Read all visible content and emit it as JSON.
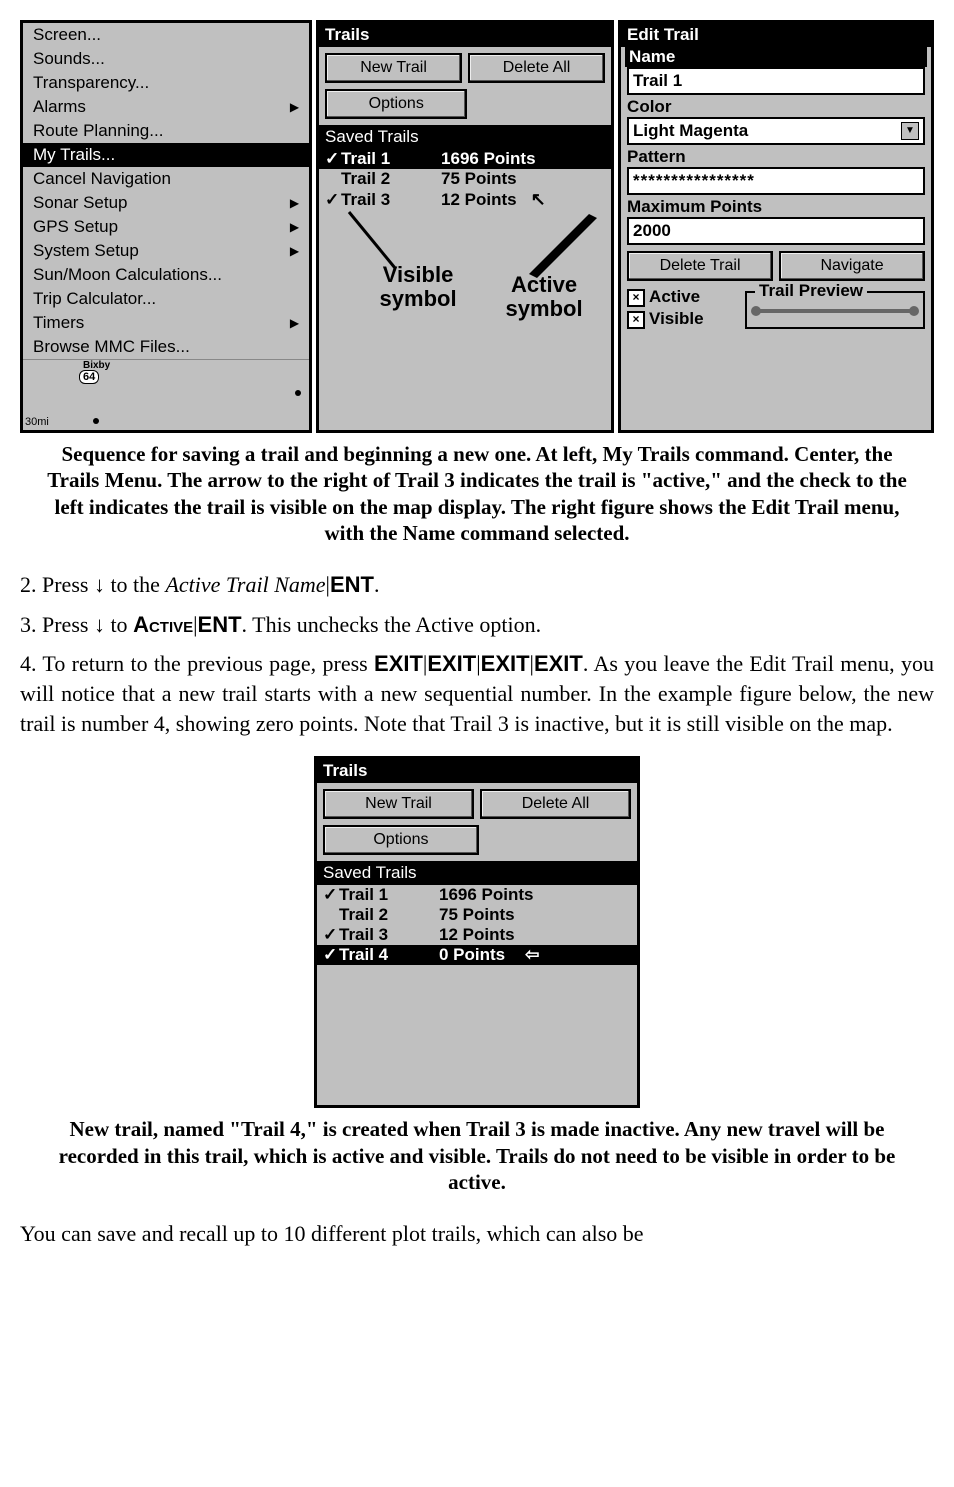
{
  "menu": {
    "items": [
      {
        "label": "Screen...",
        "sub": false
      },
      {
        "label": "Sounds...",
        "sub": false
      },
      {
        "label": "Transparency...",
        "sub": false
      },
      {
        "label": "Alarms",
        "sub": true
      },
      {
        "label": "Route Planning...",
        "sub": false
      },
      {
        "label": "My Trails...",
        "sub": false,
        "selected": true
      },
      {
        "label": "Cancel Navigation",
        "sub": false
      },
      {
        "label": "Sonar Setup",
        "sub": true
      },
      {
        "label": "GPS Setup",
        "sub": true
      },
      {
        "label": "System Setup",
        "sub": true
      },
      {
        "label": "Sun/Moon Calculations...",
        "sub": false
      },
      {
        "label": "Trip Calculator...",
        "sub": false
      },
      {
        "label": "Timers",
        "sub": true
      },
      {
        "label": "Browse MMC Files...",
        "sub": false
      }
    ],
    "map_label_top": "Bixby",
    "map_label_hwy": "64",
    "map_scale": "30mi"
  },
  "trails1": {
    "title": "Trails",
    "new_trail": "New Trail",
    "delete_all": "Delete All",
    "options": "Options",
    "saved": "Saved Trails",
    "rows": [
      {
        "check": "✓",
        "name": "Trail 1",
        "pts": "1696 Points",
        "selected": true
      },
      {
        "check": "",
        "name": "Trail 2",
        "pts": "75 Points"
      },
      {
        "check": "✓",
        "name": "Trail 3",
        "pts": "12 Points",
        "active_arrow": true
      }
    ],
    "annot_visible": "Visible symbol",
    "annot_active": "Active symbol"
  },
  "edit": {
    "title": "Edit Trail",
    "name_lbl": "Name",
    "name_val": "Trail 1",
    "color_lbl": "Color",
    "color_val": "Light Magenta",
    "pattern_lbl": "Pattern",
    "pattern_val": "****************",
    "max_lbl": "Maximum Points",
    "max_val": "2000",
    "delete": "Delete Trail",
    "navigate": "Navigate",
    "active": "Active",
    "visible": "Visible",
    "preview": "Trail Preview"
  },
  "caption1": "Sequence for saving a trail and beginning a new one. At left, My Trails command. Center, the Trails Menu. The arrow to the right of Trail 3 indicates the trail is \"active,\" and the check to the left indicates the trail is visible on the map display. The right figure shows the Edit Trail menu, with the Name command selected.",
  "step2_a": "2. Press ↓ to the ",
  "step2_b": "Active Trail Name",
  "step2_c": "|",
  "step2_d": "ENT",
  "step2_e": ".",
  "step3_a": "3. Press ↓ to ",
  "step3_b": "Active",
  "step3_c": "|",
  "step3_d": "ENT",
  "step3_e": ". This unchecks the Active option.",
  "para4_a": "4. To return to the previous page, press ",
  "para4_b": "EXIT",
  "para4_c": "|",
  "para4_d": ". As you leave the Edit Trail menu, you will notice that a new trail starts with a new sequential number. In the example figure below, the new trail is number 4, showing zero points. Note that Trail 3 is inactive, but it is still visible on the map.",
  "trails2": {
    "title": "Trails",
    "new_trail": "New Trail",
    "delete_all": "Delete All",
    "options": "Options",
    "saved": "Saved Trails",
    "rows": [
      {
        "check": "✓",
        "name": "Trail 1",
        "pts": "1696 Points"
      },
      {
        "check": "",
        "name": "Trail 2",
        "pts": "75 Points"
      },
      {
        "check": "✓",
        "name": "Trail 3",
        "pts": "12 Points"
      },
      {
        "check": "✓",
        "name": "Trail 4",
        "pts": "0 Points",
        "selected": true,
        "active_arrow": true
      }
    ]
  },
  "caption2": "New trail, named \"Trail 4,\" is created when Trail 3 is made inactive. Any new travel will be recorded in this trail, which is active and visible. Trails do not need to be visible in order to be active.",
  "closing": "You can save and recall up to 10 different plot trails, which can also be"
}
